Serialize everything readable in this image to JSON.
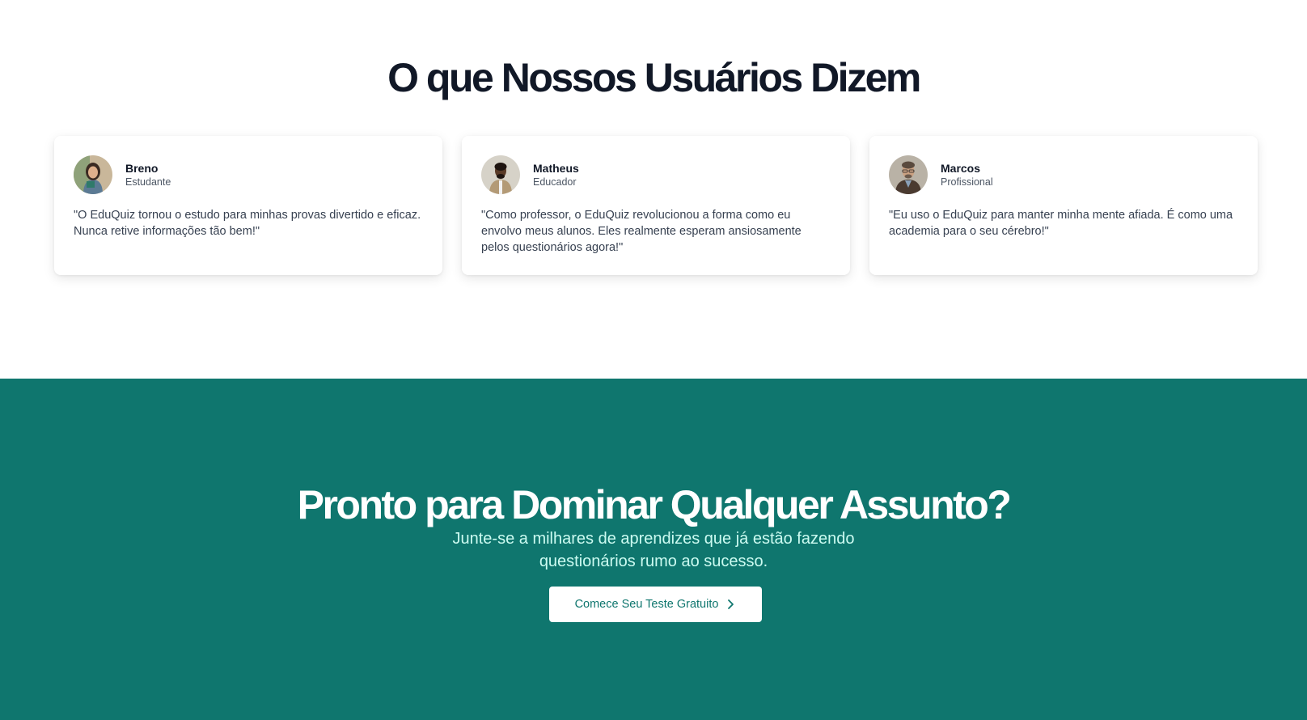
{
  "testimonials": {
    "title": "O que Nossos Usuários Dizem",
    "items": [
      {
        "name": "Breno",
        "role": "Estudante",
        "quote": "\"O EduQuiz tornou o estudo para minhas provas divertido e eficaz. Nunca retive informações tão bem!\"",
        "avatar_icon": "avatar-photo"
      },
      {
        "name": "Matheus",
        "role": "Educador",
        "quote": "\"Como professor, o EduQuiz revolucionou a forma como eu envolvo meus alunos. Eles realmente esperam ansiosamente pelos questionários agora!\"",
        "avatar_icon": "avatar-photo"
      },
      {
        "name": "Marcos",
        "role": "Profissional",
        "quote": "\"Eu uso o EduQuiz para manter minha mente afiada. É como uma academia para o seu cérebro!\"",
        "avatar_icon": "avatar-photo"
      }
    ]
  },
  "cta": {
    "title": "Pronto para Dominar Qualquer Assunto?",
    "subtitle": "Junte-se a milhares de aprendizes que já estão fazendo questionários rumo ao sucesso.",
    "button_label": "Comece Seu Teste Gratuito",
    "button_icon": "chevron-right-icon"
  },
  "colors": {
    "heading": "#111827",
    "cta_background": "#0f766e",
    "cta_subtitle": "#ccfbf1",
    "card_background": "#ffffff"
  }
}
